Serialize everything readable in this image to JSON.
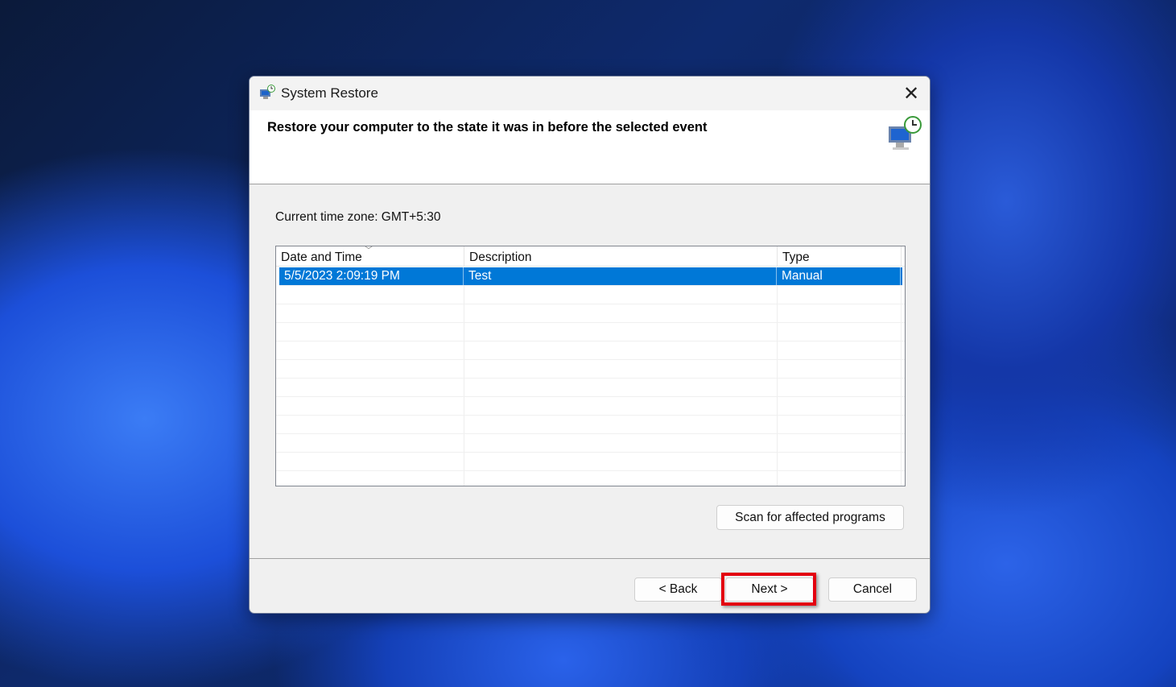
{
  "window": {
    "title": "System Restore",
    "close_label": "✕"
  },
  "header": {
    "heading": "Restore your computer to the state it was in before the selected event"
  },
  "timezone": "Current time zone: GMT+5:30",
  "table": {
    "columns": [
      "Date and Time",
      "Description",
      "Type"
    ],
    "rows": [
      {
        "date": "5/5/2023 2:09:19 PM",
        "description": "Test",
        "type": "Manual",
        "selected": true
      }
    ]
  },
  "buttons": {
    "scan": "Scan for affected programs",
    "back": "< Back",
    "next": "Next >",
    "cancel": "Cancel"
  },
  "colors": {
    "selection": "#0078d7",
    "highlight": "#e3000f"
  }
}
